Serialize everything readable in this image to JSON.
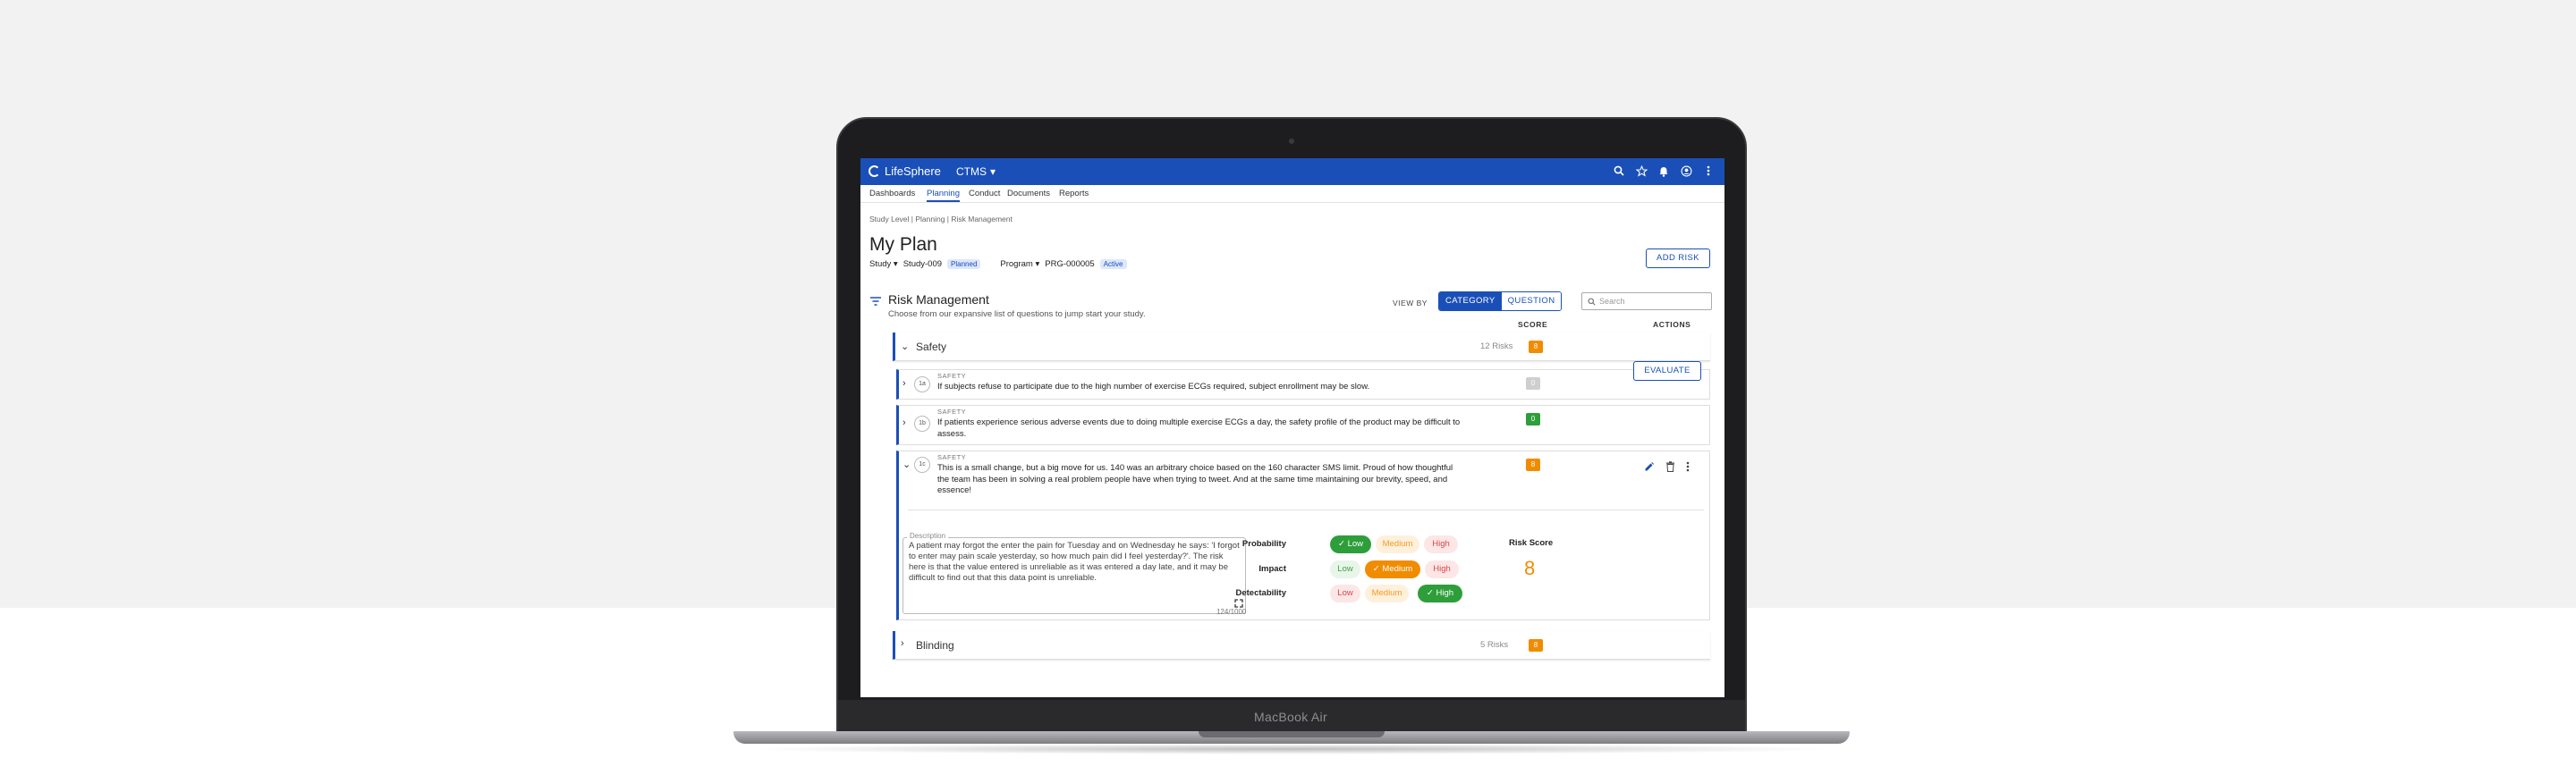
{
  "device": {
    "label": "MacBook Air"
  },
  "app": {
    "logo": "LifeSphere",
    "module": "CTMS"
  },
  "nav": {
    "tabs": [
      "Dashboards",
      "Planning",
      "Conduct",
      "Documents",
      "Reports"
    ],
    "active": "Planning"
  },
  "breadcrumb": "Study Level | Planning | Risk Management",
  "page": {
    "title": "My Plan",
    "study_label": "Study",
    "study_value": "Study-009",
    "study_status": "Planned",
    "program_label": "Program",
    "program_value": "PRG-000005",
    "program_status": "Active",
    "add_button": "ADD RISK"
  },
  "section": {
    "title": "Risk Management",
    "subtitle": "Choose from our expansive list of questions to jump start your study.",
    "view_by": "VIEW BY",
    "view_options": [
      "CATEGORY",
      "QUESTION"
    ],
    "search_placeholder": "Search",
    "col_score": "SCORE",
    "col_actions": "ACTIONS"
  },
  "groups": [
    {
      "name": "Safety",
      "count": "12 Risks",
      "score": "8"
    },
    {
      "name": "Blinding",
      "count": "5 Risks",
      "score": "8"
    }
  ],
  "risks": [
    {
      "num": "1a",
      "category": "SAFETY",
      "text": "If subjects refuse to participate due to the high number of exercise ECGs required, subject enrollment may be slow.",
      "score": "0",
      "action": "EVALUATE"
    },
    {
      "num": "1b",
      "category": "SAFETY",
      "text": "If patients experience serious adverse events due to doing multiple exercise ECGs a day, the safety profile of the product may be difficult to assess.",
      "score": "0"
    },
    {
      "num": "1c",
      "category": "SAFETY",
      "text": "This is a small change, but a big move for us. 140 was an arbitrary choice based on the 160 character SMS limit. Proud of how thoughtful the team has been in solving a real problem people have when trying to tweet. And at the same time maintaining our brevity, speed, and essence!",
      "score": "8"
    }
  ],
  "detail": {
    "description_label": "Description",
    "description": "A patient may forgot the enter the pain for Tuesday and on Wednesday he says: 'I forgot to enter may pain scale yesterday, so how much pain did I feel yesterday?'. The risk here is that the value entered is unreliable as it was entered a day late, and it may be difficult to find out that this data point is unreliable.",
    "counter": "124/1000",
    "probability_label": "Probability",
    "impact_label": "Impact",
    "detectability_label": "Detectability",
    "levels": [
      "Low",
      "Medium",
      "High"
    ],
    "probability_selected": "Low",
    "impact_selected": "Medium",
    "detectability_selected": "High",
    "risk_score_label": "Risk Score",
    "risk_score": "8"
  },
  "colors": {
    "brand": "#1a4fb8",
    "score_orange": "#f08c00",
    "score_green": "#2e9e3b"
  }
}
